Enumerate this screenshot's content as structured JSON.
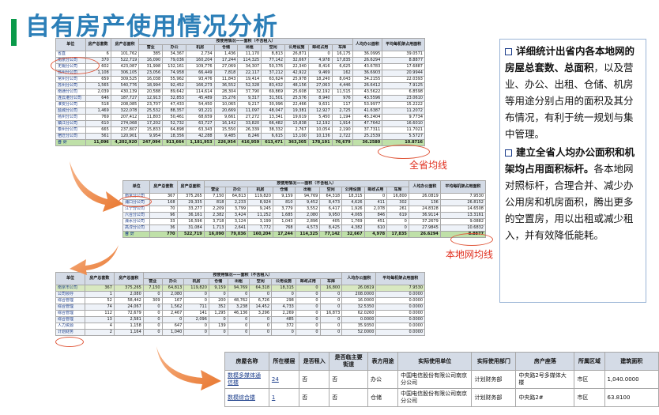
{
  "page": {
    "title": "自有房产使用情况分析"
  },
  "panel": {
    "p1_bold": "详细统计出省内各本地网的房屋总套数、总面积",
    "p1_rest": "，以及营业、办公、出租、仓储、机房等用途分别占用的面积及其分布情况，有利于统一规划与集中管理。",
    "p2_bold": "建立全省人均办公面积和机架均占用面积标杆。",
    "p2_rest": "各本地网对照标杆，合理合并、减少办公用房和机房面积，腾出更多的空置房，用以出租或减少租入，并有效降低能耗。"
  },
  "annotations": {
    "province_avg": "全省均线",
    "local_avg": "本地网均线"
  },
  "table1": {
    "group_header": "按使用情况——面积（不含租入）",
    "headers": [
      "单位",
      "房产总套数",
      "房产总面积",
      "营业",
      "办公",
      "机房",
      "仓储",
      "出租",
      "空闲",
      "公用设施",
      "邮政占用",
      "车库",
      "人均办公面积",
      "平均每机架占用面积"
    ],
    "rows": [
      [
        "省直",
        "6",
        "101,762",
        "385",
        "34,367",
        "2,734",
        "1,436",
        "11,170",
        "8,813",
        "26,871",
        "0",
        "16,175",
        "36.0995",
        "39.0571"
      ],
      [
        "南京分公司",
        "370",
        "522,719",
        "16,090",
        "79,036",
        "160,204",
        "17,244",
        "114,325",
        "77,142",
        "32,667",
        "4,978",
        "17,835",
        "26.6294",
        "8.8877"
      ],
      [
        "无锡分公司",
        "602",
        "423,087",
        "31,998",
        "132,161",
        "109,776",
        "27,069",
        "34,307",
        "50,376",
        "22,340",
        "8,416",
        "6,625",
        "43.6783",
        "17.6887"
      ],
      [
        "徐州分公司",
        "1,108",
        "306,105",
        "23,056",
        "74,958",
        "66,449",
        "7,818",
        "22,117",
        "37,212",
        "42,922",
        "9,469",
        "162",
        "36.6903",
        "20.9944"
      ],
      [
        "常州分公司",
        "659",
        "309,525",
        "16,038",
        "55,962",
        "93,476",
        "11,843",
        "19,414",
        "63,624",
        "25,978",
        "18,240",
        "8,043",
        "34.2155",
        "22.0393"
      ],
      [
        "苏州分公司",
        "1,565",
        "540,776",
        "18,994",
        "92,452",
        "166,273",
        "36,552",
        "52,328",
        "83,432",
        "48,156",
        "27,063",
        "4,446",
        "26.6412",
        "7.9125"
      ],
      [
        "南通分公司",
        "2,039",
        "430,139",
        "20,588",
        "89,642",
        "114,614",
        "28,304",
        "37,790",
        "69,869",
        "25,608",
        "32,192",
        "11,515",
        "43.5622",
        "6.8598"
      ],
      [
        "连云港分公司",
        "646",
        "187,727",
        "12,913",
        "32,853",
        "45,489",
        "15,276",
        "9,317",
        "31,501",
        "25,576",
        "8,940",
        "976",
        "43.5596",
        "23.0610"
      ],
      [
        "淮安分公司",
        "518",
        "208,085",
        "23,707",
        "47,433",
        "54,450",
        "10,065",
        "9,217",
        "30,996",
        "22,466",
        "9,631",
        "117",
        "53.9977",
        "15.2222"
      ],
      [
        "盐城分公司",
        "1,469",
        "322,078",
        "25,532",
        "88,357",
        "93,221",
        "20,669",
        "11,097",
        "48,047",
        "19,381",
        "12,927",
        "2,725",
        "41.6387",
        "11.2072"
      ],
      [
        "扬州分公司",
        "769",
        "207,412",
        "11,803",
        "50,461",
        "68,659",
        "9,661",
        "27,272",
        "13,341",
        "19,619",
        "5,450",
        "1,194",
        "45.2404",
        "9.7734"
      ],
      [
        "镇江分公司",
        "610",
        "274,068",
        "17,202",
        "52,732",
        "63,727",
        "16,142",
        "33,820",
        "66,482",
        "15,838",
        "12,192",
        "1,914",
        "47.7642",
        "16.6010"
      ],
      [
        "泰州分公司",
        "665",
        "237,807",
        "15,833",
        "64,898",
        "63,343",
        "15,550",
        "26,339",
        "38,332",
        "2,767",
        "10,054",
        "2,190",
        "37.7311",
        "11.7021"
      ],
      [
        "宿迁分公司",
        "561",
        "120,901",
        "9,954",
        "18,356",
        "42,288",
        "9,485",
        "8,246",
        "6,615",
        "13,100",
        "10,136",
        "2,722",
        "25.2539",
        "5.5727"
      ],
      [
        "合  计",
        "11,096",
        "4,202,920",
        "247,094",
        "913,664",
        "1,181,953",
        "226,954",
        "416,959",
        "613,471",
        "363,305",
        "178,191",
        "76,679",
        "36.2580",
        "10.8716"
      ]
    ]
  },
  "table2": {
    "group_header": "按使用情况——面积（不含租入）",
    "headers": [
      "单位",
      "房产总套数",
      "房产总面积",
      "营业",
      "办公",
      "机房",
      "仓储",
      "出租",
      "空闲",
      "公用设施",
      "邮政占用",
      "车库",
      "人均办公面积",
      "平均每机架占用面积"
    ],
    "rows": [
      [
        "南京分公司",
        "367",
        "375,265",
        "7,150",
        "64,813",
        "119,820",
        "9,159",
        "94,769",
        "64,318",
        "18,315",
        "0",
        "16,800",
        "26.0819",
        "7.9530"
      ],
      [
        "浦口分公司",
        "168",
        "29,335",
        "818",
        "2,233",
        "8,924",
        "810",
        "9,452",
        "8,473",
        "4,626",
        "411",
        "302",
        "136",
        "26.8152"
      ],
      [
        "江宁分公司",
        "70",
        "33,277",
        "2,209",
        "3,799",
        "9,245",
        "3,779",
        "3,552",
        "6,417",
        "1,926",
        "2,078",
        "261",
        "24.8328",
        "14.6508"
      ],
      [
        "六合分公司",
        "96",
        "36,161",
        "2,382",
        "3,424",
        "11,252",
        "1,685",
        "2,080",
        "9,950",
        "4,065",
        "846",
        "619",
        "36.9114",
        "13.3161"
      ],
      [
        "溧水分公司",
        "33",
        "16,596",
        "3,718",
        "3,124",
        "3,199",
        "1,043",
        "2,896",
        "405",
        "1,769",
        "451",
        "0",
        "37.2679",
        "9.0882"
      ],
      [
        "高淳分公司",
        "36",
        "31,084",
        "1,713",
        "2,641",
        "7,772",
        "768",
        "4,573",
        "8,425",
        "4,382",
        "610",
        "0",
        "27.9845",
        "10.6832"
      ],
      [
        "合  计",
        "770",
        "522,719",
        "16,090",
        "79,036",
        "160,204",
        "17,244",
        "114,325",
        "77,142",
        "32,667",
        "4,978",
        "17,835",
        "26.6294",
        "8.8877"
      ]
    ]
  },
  "table3": {
    "group_header": "按使用情况——面积（不含租入）",
    "headers": [
      "单位",
      "房产总套数",
      "房产总面积",
      "营业",
      "办公",
      "机房",
      "仓储",
      "出租",
      "空闲",
      "公用设施",
      "邮政占用",
      "车库",
      "人均办公面积",
      "平均每机架占用面积"
    ],
    "rows": [
      [
        "南京市公司",
        "367",
        "375,265",
        "7,150",
        "64,813",
        "119,820",
        "9,159",
        "94,769",
        "64,318",
        "18,315",
        "0",
        "16,800",
        "26.0819",
        "7.9530"
      ],
      [
        "公司领导",
        "1",
        "2,080",
        "0",
        "2,080",
        "0",
        "0",
        "0",
        "0",
        "0",
        "0",
        "0",
        "208.0000",
        "0.0000"
      ],
      [
        "综合管理",
        "52",
        "58,442",
        "309",
        "167",
        "0",
        "200",
        "48,762",
        "6,726",
        "298",
        "0",
        "0",
        "16.0000",
        "0.0000"
      ],
      [
        "综合管理",
        "74",
        "24,067",
        "0",
        "1,562",
        "711",
        "352",
        "3,238",
        "14,452",
        "4,733",
        "0",
        "0",
        "32.5350",
        "0.0000"
      ],
      [
        "综合管理",
        "112",
        "72,679",
        "0",
        "2,467",
        "141",
        "1,295",
        "46,136",
        "3,296",
        "2,269",
        "0",
        "16,873",
        "62.0260",
        "0.0000"
      ],
      [
        "综合管理",
        "13",
        "2,581",
        "0",
        "0",
        "2,096",
        "0",
        "0",
        "0",
        "485",
        "0",
        "0",
        "0.0000",
        "0.0000"
      ],
      [
        "人力资源",
        "4",
        "1,158",
        "0",
        "647",
        "0",
        "139",
        "0",
        "0",
        "372",
        "0",
        "0",
        "35.9350",
        "0.0000"
      ],
      [
        "计划财务",
        "2",
        "1,164",
        "0",
        "1,040",
        "0",
        "0",
        "0",
        "0",
        "0",
        "0",
        "0",
        "52.0000",
        "0.0000"
      ]
    ]
  },
  "table4": {
    "headers": [
      "房屋名称",
      "所在楼层",
      "是否租入",
      "是否临主要街道",
      "表方用途",
      "实际使用单位",
      "实际使用部门",
      "房产座落",
      "所属区域",
      "建筑面积"
    ],
    "rows": [
      [
        "数模多媒体通信楼",
        "24",
        "否",
        "否",
        "办公",
        "中国电信股份有限公司南京分公司",
        "计划财务部",
        "中央路2号多媒体大楼",
        "市区",
        "1,040.0000"
      ],
      [
        "数模综合楼",
        "1",
        "否",
        "否",
        "仓储",
        "中国电信股份有限公司南京分公司",
        "计划财务部",
        "中央路2#",
        "市区",
        "63.8100"
      ]
    ]
  }
}
